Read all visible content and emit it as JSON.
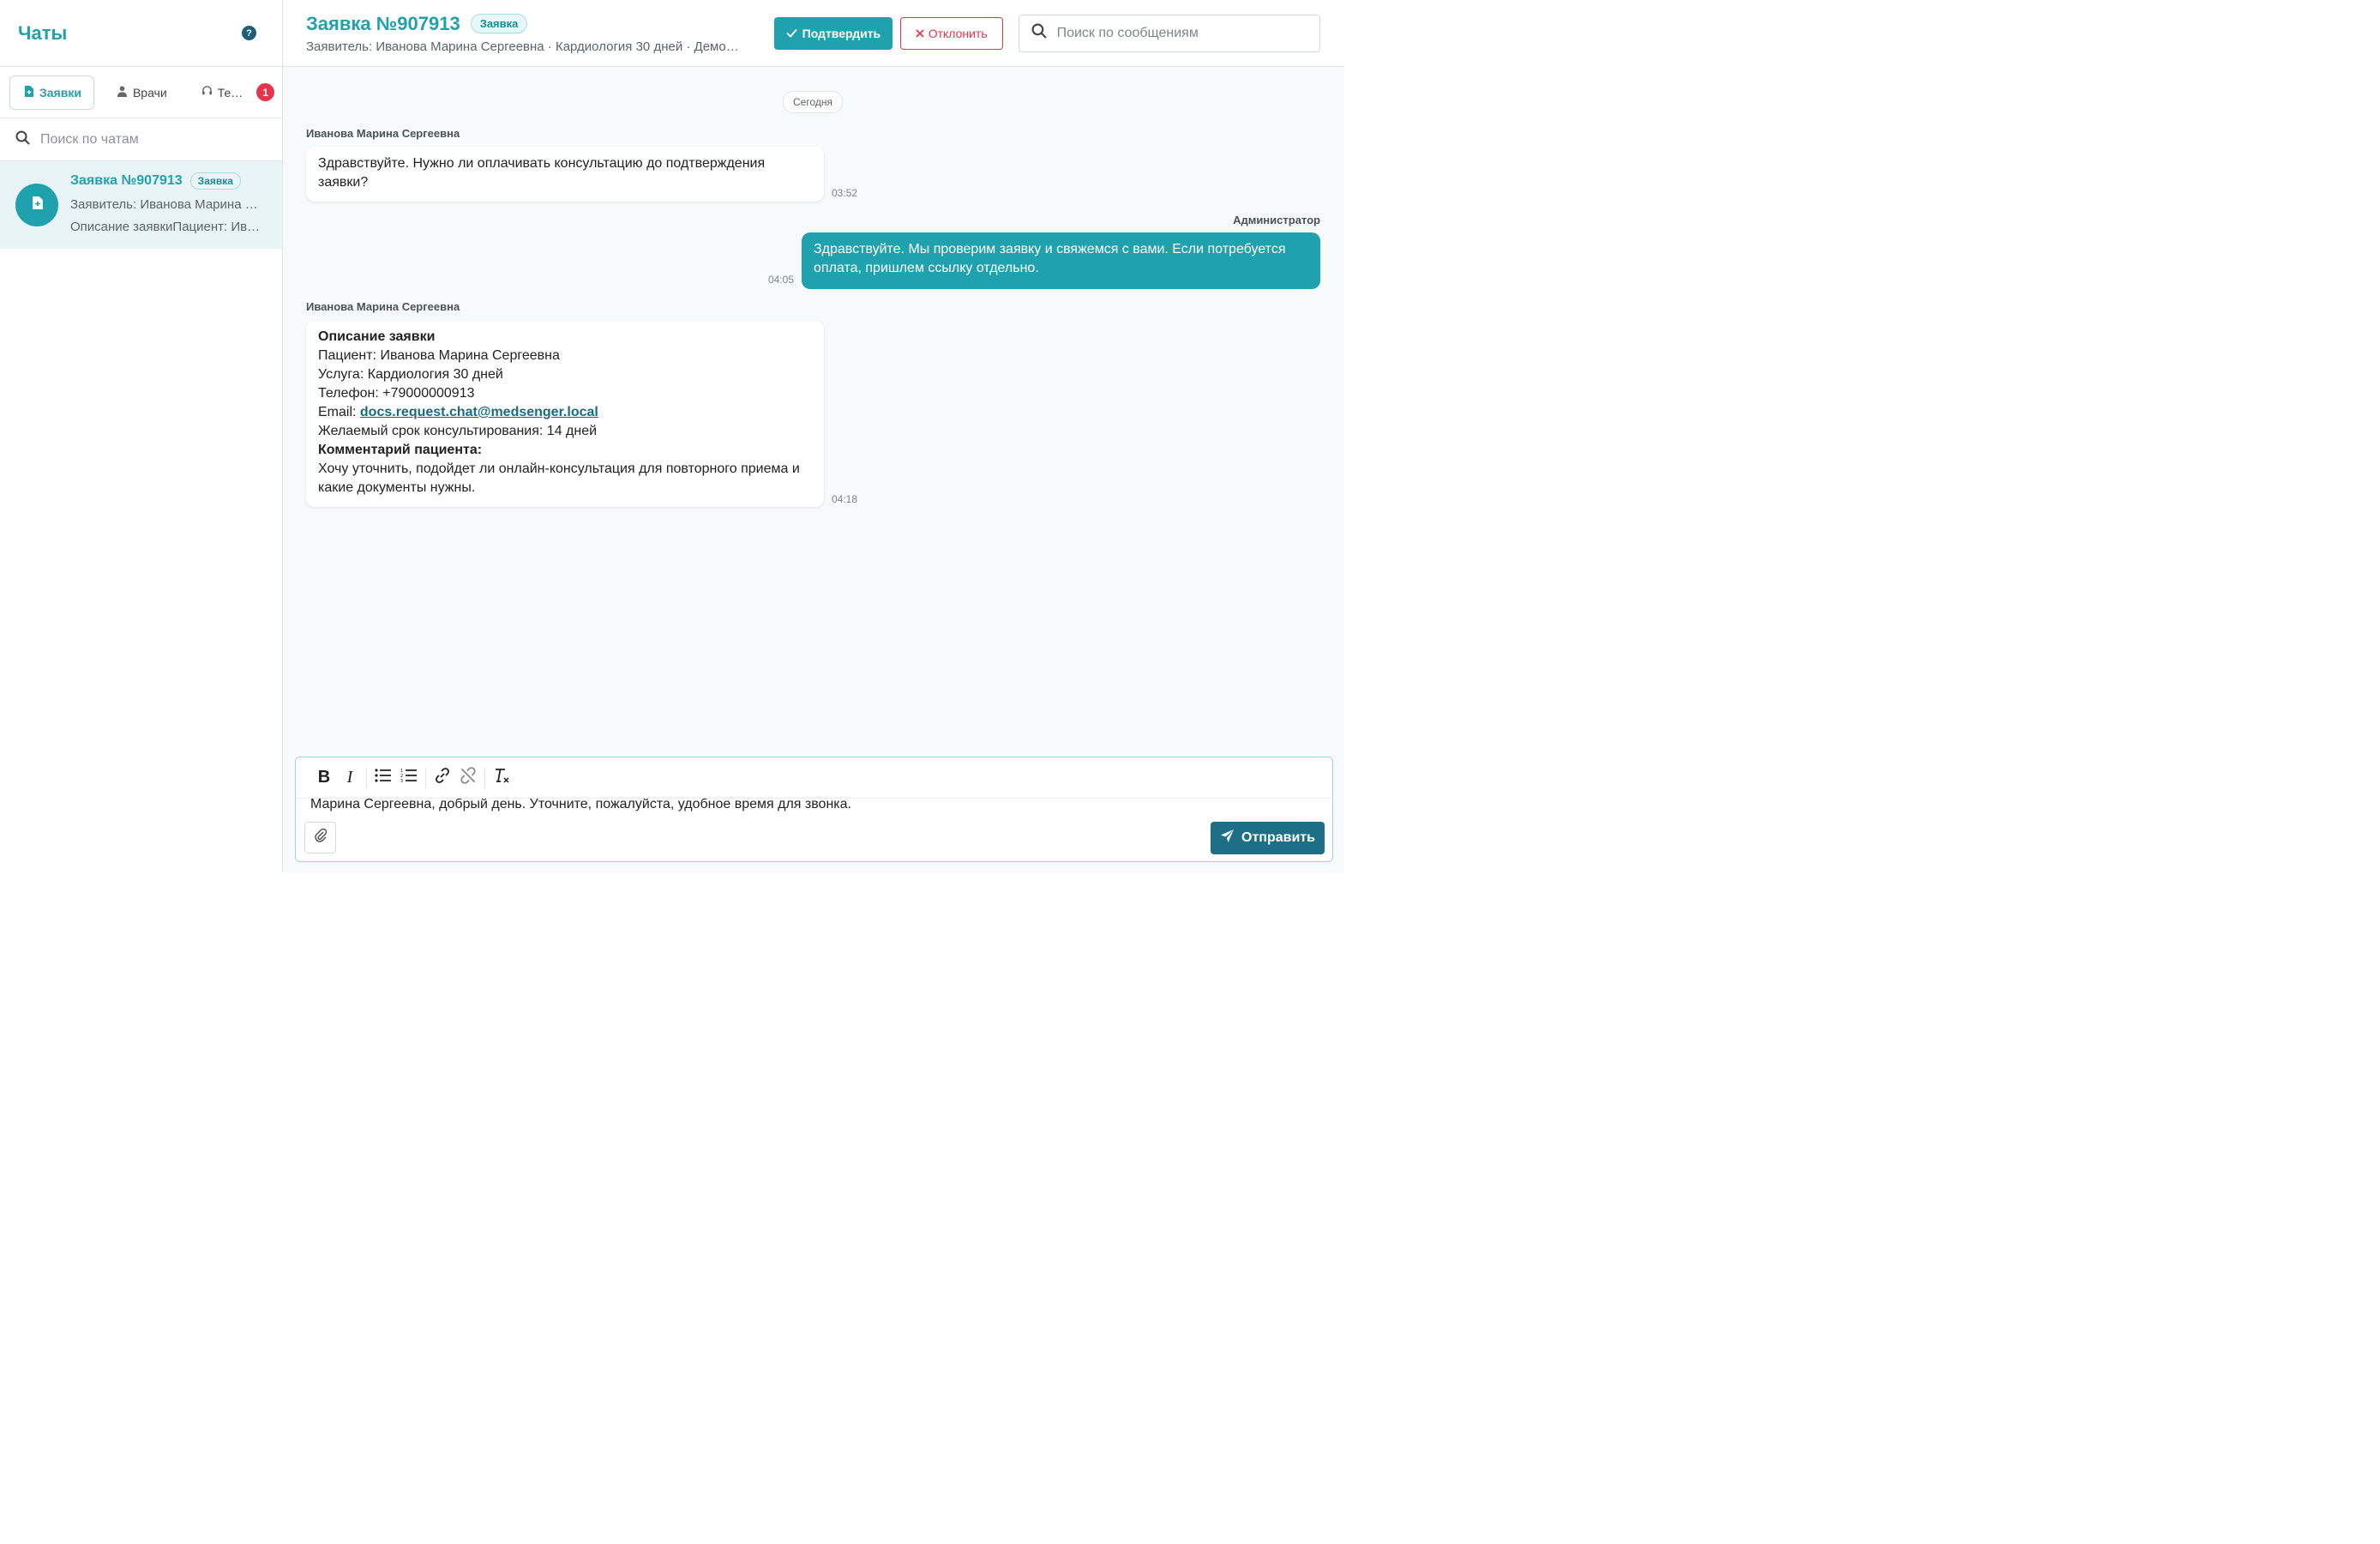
{
  "sidebar": {
    "title": "Чаты",
    "help_icon": "?",
    "tabs": [
      {
        "label": "Заявки",
        "icon": "document-plus-icon",
        "active": true
      },
      {
        "label": "Врачи",
        "icon": "doctor-icon",
        "active": false
      },
      {
        "label": "Те…",
        "icon": "headset-icon",
        "active": false,
        "badge": "1"
      }
    ],
    "search_placeholder": "Поиск по чатам",
    "chats": [
      {
        "title": "Заявка №907913",
        "tag": "Заявка",
        "line1": "Заявитель: Иванова Марина Сергеевна",
        "line2": "Описание заявкиПациент: Иванова Марина Сергеевна"
      }
    ]
  },
  "header": {
    "title": "Заявка №907913",
    "tag": "Заявка",
    "subtitle": "Заявитель: Иванова Марина Сергеевна · Кардиология 30 дней · Демо…",
    "confirm_label": "Подтвердить",
    "reject_label": "Отклонить",
    "search_placeholder": "Поиск по сообщениям"
  },
  "messages": {
    "date_label": "Сегодня",
    "items": [
      {
        "sender": "Иванова Марина Сергеевна",
        "text": "Здравствуйте. Нужно ли оплачивать консультацию до подтверждения заявки?",
        "time": "03:52"
      },
      {
        "sender": "Администратор",
        "text": "Здравствуйте. Мы проверим заявку и свяжемся с вами. Если потребуется оплата, пришлем ссылку отдельно.",
        "time": "04:05"
      },
      {
        "sender": "Иванова Марина Сергеевна",
        "heading": "Описание заявки",
        "patient": "Пациент: Иванова Марина Сергеевна",
        "service": "Услуга: Кардиология 30 дней",
        "phone": "Телефон: +79000000913",
        "email_label": "Email: ",
        "email": "docs.request.chat@medsenger.local",
        "term": "Желаемый срок консультирования: 14 дней",
        "comment_heading": "Комментарий пациента:",
        "comment": "Хочу уточнить, подойдет ли онлайн-консультация для повторного приема и какие документы нужны.",
        "time": "04:18"
      }
    ]
  },
  "composer": {
    "text": "Марина Сергеевна, добрый день. Уточните, пожалуйста, удобное время для звонка.",
    "send_label": "Отправить"
  },
  "colors": {
    "accent": "#1fa2ad",
    "send_button": "#1d6f86",
    "danger": "#e5344b"
  }
}
